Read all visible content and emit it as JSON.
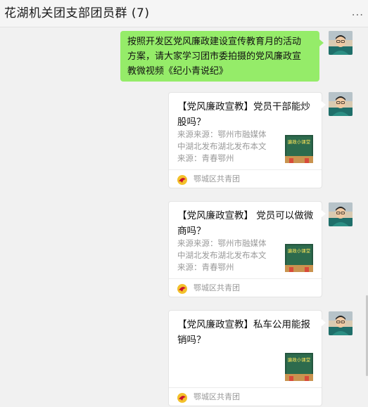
{
  "header": {
    "title": "花湖机关团支部团员群 (7)",
    "more_label": "..."
  },
  "messages": {
    "text": {
      "lines": [
        "按照开发区党风廉政建设宣传教育月的活动",
        "方案，请大家学习团市委拍摄的党风廉政宣",
        "教微视频《纪小青说纪》"
      ]
    },
    "cards": [
      {
        "title_lines": [
          "【党风廉政宣教】党员干部能炒",
          "股吗？"
        ],
        "desc_lines": [
          "来源来源：鄂州市融媒体",
          "中湖北发布湖北发布本文",
          "来源：青春鄂州"
        ],
        "source": "鄂城区共青团",
        "thumb_text": "廉政小课堂"
      },
      {
        "title_lines": [
          "【党风廉政宣教】 党员可以做微",
          "商吗？"
        ],
        "desc_lines": [
          "来源来源：鄂州市融媒体",
          "中湖北发布湖北发布本文",
          "来源：青春鄂州"
        ],
        "source": "鄂城区共青团",
        "thumb_text": "廉政小课堂"
      },
      {
        "title_lines": [
          "【党风廉政宣教】私车公用能报",
          "销吗？"
        ],
        "desc_lines": [],
        "source": "鄂城区共青团",
        "thumb_text": "廉政小课堂"
      }
    ]
  },
  "colors": {
    "bubble_green": "#95ec69",
    "background": "#f1f1f1",
    "source_icon": "#c8102e"
  }
}
